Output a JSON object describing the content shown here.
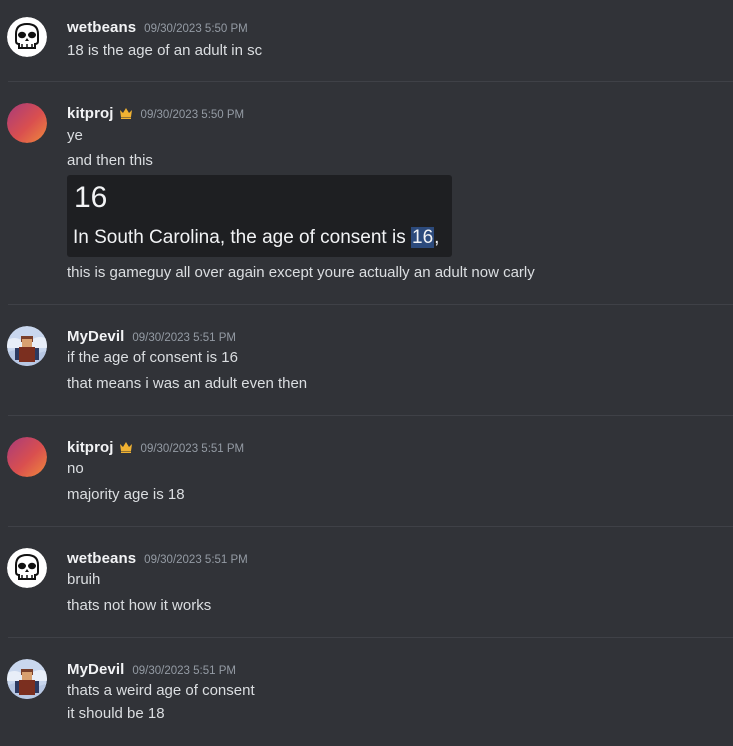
{
  "messages": [
    {
      "username": "wetbeans",
      "timestamp": "09/30/2023 5:50 PM",
      "avatar": "skull-icon",
      "lines": [
        "18 is the age of an adult in sc"
      ]
    },
    {
      "username": "kitproj",
      "timestamp": "09/30/2023 5:50 PM",
      "avatar": "gradient-orb",
      "crown": true,
      "lines": [
        "ye",
        "and then this"
      ],
      "embed": {
        "title": "16",
        "body_pre": "In South Carolina, the age of consent is ",
        "body_highlight": "16",
        "body_post": ","
      },
      "after_lines": [
        "this is gameguy all over again except youre actually an adult now carly"
      ]
    },
    {
      "username": "MyDevil",
      "timestamp": "09/30/2023 5:51 PM",
      "avatar": "roblox-avatar",
      "lines": [
        "if the age of consent is 16",
        "that means i was an adult even then"
      ]
    },
    {
      "username": "kitproj",
      "timestamp": "09/30/2023 5:51 PM",
      "avatar": "gradient-orb",
      "crown": true,
      "lines": [
        "no",
        "majority age is 18"
      ]
    },
    {
      "username": "wetbeans",
      "timestamp": "09/30/2023 5:51 PM",
      "avatar": "skull-icon",
      "lines": [
        "bruih",
        "thats not how it works"
      ]
    },
    {
      "username": "MyDevil",
      "timestamp": "09/30/2023 5:51 PM",
      "avatar": "roblox-avatar",
      "lines": [
        "thats a weird age of consent",
        "it should be 18"
      ]
    }
  ],
  "colors": {
    "background": "#313338",
    "username": "#f2f3f5",
    "timestamp": "#949ba4",
    "text": "#dbdee1",
    "embed_bg": "#1e1f22",
    "highlight": "#2c4a7c",
    "crown": "#f0b232"
  }
}
